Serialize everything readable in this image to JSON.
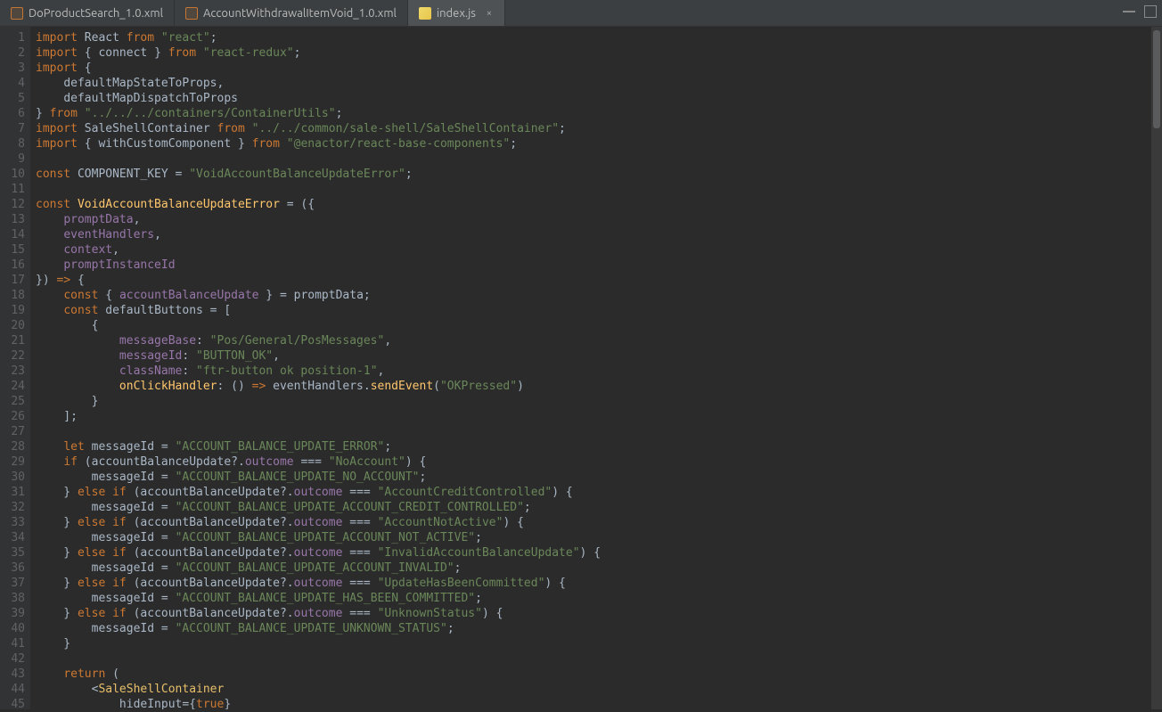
{
  "tabs": [
    {
      "label": "DoProductSearch_1.0.xml",
      "kind": "xml",
      "active": false
    },
    {
      "label": "AccountWithdrawalItemVoid_1.0.xml",
      "kind": "xml",
      "active": false
    },
    {
      "label": "index.js",
      "kind": "js",
      "active": true
    }
  ],
  "code_lines": [
    [
      [
        "kw",
        "import"
      ],
      [
        "pun",
        " "
      ],
      [
        "cls",
        "React"
      ],
      [
        "pun",
        " "
      ],
      [
        "kw",
        "from"
      ],
      [
        "pun",
        " "
      ],
      [
        "str",
        "\"react\""
      ],
      [
        "pun",
        ";"
      ]
    ],
    [
      [
        "kw",
        "import"
      ],
      [
        "pun",
        " { "
      ],
      [
        "cls",
        "connect"
      ],
      [
        "pun",
        " } "
      ],
      [
        "kw",
        "from"
      ],
      [
        "pun",
        " "
      ],
      [
        "str",
        "\"react-redux\""
      ],
      [
        "pun",
        ";"
      ]
    ],
    [
      [
        "kw",
        "import"
      ],
      [
        "pun",
        " {"
      ]
    ],
    [
      [
        "pun",
        "    "
      ],
      [
        "cls",
        "defaultMapStateToProps"
      ],
      [
        "pun",
        ","
      ]
    ],
    [
      [
        "pun",
        "    "
      ],
      [
        "cls",
        "defaultMapDispatchToProps"
      ]
    ],
    [
      [
        "pun",
        "} "
      ],
      [
        "kw",
        "from"
      ],
      [
        "pun",
        " "
      ],
      [
        "str",
        "\"../../../containers/ContainerUtils\""
      ],
      [
        "pun",
        ";"
      ]
    ],
    [
      [
        "kw",
        "import"
      ],
      [
        "pun",
        " "
      ],
      [
        "cls",
        "SaleShellContainer"
      ],
      [
        "pun",
        " "
      ],
      [
        "kw",
        "from"
      ],
      [
        "pun",
        " "
      ],
      [
        "str",
        "\"../../common/sale-shell/SaleShellContainer\""
      ],
      [
        "pun",
        ";"
      ]
    ],
    [
      [
        "kw",
        "import"
      ],
      [
        "pun",
        " { "
      ],
      [
        "cls",
        "withCustomComponent"
      ],
      [
        "pun",
        " } "
      ],
      [
        "kw",
        "from"
      ],
      [
        "pun",
        " "
      ],
      [
        "str",
        "\"@enactor/react-base-components\""
      ],
      [
        "pun",
        ";"
      ]
    ],
    [],
    [
      [
        "kw",
        "const"
      ],
      [
        "pun",
        " "
      ],
      [
        "id",
        "COMPONENT_KEY"
      ],
      [
        "pun",
        " = "
      ],
      [
        "str",
        "\"VoidAccountBalanceUpdateError\""
      ],
      [
        "pun",
        ";"
      ]
    ],
    [],
    [
      [
        "kw",
        "const"
      ],
      [
        "pun",
        " "
      ],
      [
        "fn",
        "VoidAccountBalanceUpdateError"
      ],
      [
        "pun",
        " = ({"
      ]
    ],
    [
      [
        "pun",
        "    "
      ],
      [
        "prop",
        "promptData"
      ],
      [
        "pun",
        ","
      ]
    ],
    [
      [
        "pun",
        "    "
      ],
      [
        "prop",
        "eventHandlers"
      ],
      [
        "pun",
        ","
      ]
    ],
    [
      [
        "pun",
        "    "
      ],
      [
        "prop",
        "context"
      ],
      [
        "pun",
        ","
      ]
    ],
    [
      [
        "pun",
        "    "
      ],
      [
        "prop",
        "promptInstanceId"
      ]
    ],
    [
      [
        "pun",
        "}) "
      ],
      [
        "kw",
        "=>"
      ],
      [
        "pun",
        " {"
      ]
    ],
    [
      [
        "pun",
        "    "
      ],
      [
        "kw",
        "const"
      ],
      [
        "pun",
        " { "
      ],
      [
        "prop",
        "accountBalanceUpdate"
      ],
      [
        "pun",
        " } = "
      ],
      [
        "id",
        "promptData"
      ],
      [
        "pun",
        ";"
      ]
    ],
    [
      [
        "pun",
        "    "
      ],
      [
        "kw",
        "const"
      ],
      [
        "pun",
        " "
      ],
      [
        "id",
        "defaultButtons"
      ],
      [
        "pun",
        " = ["
      ]
    ],
    [
      [
        "pun",
        "        {"
      ]
    ],
    [
      [
        "pun",
        "            "
      ],
      [
        "prop",
        "messageBase"
      ],
      [
        "pun",
        ": "
      ],
      [
        "str",
        "\"Pos/General/PosMessages\""
      ],
      [
        "pun",
        ","
      ]
    ],
    [
      [
        "pun",
        "            "
      ],
      [
        "prop",
        "messageId"
      ],
      [
        "pun",
        ": "
      ],
      [
        "str",
        "\"BUTTON_OK\""
      ],
      [
        "pun",
        ","
      ]
    ],
    [
      [
        "pun",
        "            "
      ],
      [
        "prop",
        "className"
      ],
      [
        "pun",
        ": "
      ],
      [
        "str",
        "\"ftr-button ok position-1\""
      ],
      [
        "pun",
        ","
      ]
    ],
    [
      [
        "pun",
        "            "
      ],
      [
        "fn",
        "onClickHandler"
      ],
      [
        "pun",
        ": () "
      ],
      [
        "kw",
        "=>"
      ],
      [
        "pun",
        " "
      ],
      [
        "id",
        "eventHandlers"
      ],
      [
        "pun",
        "."
      ],
      [
        "fn",
        "sendEvent"
      ],
      [
        "pun",
        "("
      ],
      [
        "str",
        "\"OKPressed\""
      ],
      [
        "pun",
        ")"
      ]
    ],
    [
      [
        "pun",
        "        }"
      ]
    ],
    [
      [
        "pun",
        "    ];"
      ]
    ],
    [],
    [
      [
        "pun",
        "    "
      ],
      [
        "kw",
        "let"
      ],
      [
        "pun",
        " "
      ],
      [
        "id",
        "messageId"
      ],
      [
        "pun",
        " = "
      ],
      [
        "str",
        "\"ACCOUNT_BALANCE_UPDATE_ERROR\""
      ],
      [
        "pun",
        ";"
      ]
    ],
    [
      [
        "pun",
        "    "
      ],
      [
        "kw",
        "if"
      ],
      [
        "pun",
        " ("
      ],
      [
        "id",
        "accountBalanceUpdate"
      ],
      [
        "pun",
        "?."
      ],
      [
        "prop",
        "outcome"
      ],
      [
        "pun",
        " === "
      ],
      [
        "str",
        "\"NoAccount\""
      ],
      [
        "pun",
        ") {"
      ]
    ],
    [
      [
        "pun",
        "        "
      ],
      [
        "id",
        "messageId"
      ],
      [
        "pun",
        " = "
      ],
      [
        "str",
        "\"ACCOUNT_BALANCE_UPDATE_NO_ACCOUNT\""
      ],
      [
        "pun",
        ";"
      ]
    ],
    [
      [
        "pun",
        "    } "
      ],
      [
        "kw",
        "else if"
      ],
      [
        "pun",
        " ("
      ],
      [
        "id",
        "accountBalanceUpdate"
      ],
      [
        "pun",
        "?."
      ],
      [
        "prop",
        "outcome"
      ],
      [
        "pun",
        " === "
      ],
      [
        "str",
        "\"AccountCreditControlled\""
      ],
      [
        "pun",
        ") {"
      ]
    ],
    [
      [
        "pun",
        "        "
      ],
      [
        "id",
        "messageId"
      ],
      [
        "pun",
        " = "
      ],
      [
        "str",
        "\"ACCOUNT_BALANCE_UPDATE_ACCOUNT_CREDIT_CONTROLLED\""
      ],
      [
        "pun",
        ";"
      ]
    ],
    [
      [
        "pun",
        "    } "
      ],
      [
        "kw",
        "else if"
      ],
      [
        "pun",
        " ("
      ],
      [
        "id",
        "accountBalanceUpdate"
      ],
      [
        "pun",
        "?."
      ],
      [
        "prop",
        "outcome"
      ],
      [
        "pun",
        " === "
      ],
      [
        "str",
        "\"AccountNotActive\""
      ],
      [
        "pun",
        ") {"
      ]
    ],
    [
      [
        "pun",
        "        "
      ],
      [
        "id",
        "messageId"
      ],
      [
        "pun",
        " = "
      ],
      [
        "str",
        "\"ACCOUNT_BALANCE_UPDATE_ACCOUNT_NOT_ACTIVE\""
      ],
      [
        "pun",
        ";"
      ]
    ],
    [
      [
        "pun",
        "    } "
      ],
      [
        "kw",
        "else if"
      ],
      [
        "pun",
        " ("
      ],
      [
        "id",
        "accountBalanceUpdate"
      ],
      [
        "pun",
        "?."
      ],
      [
        "prop",
        "outcome"
      ],
      [
        "pun",
        " === "
      ],
      [
        "str",
        "\"InvalidAccountBalanceUpdate\""
      ],
      [
        "pun",
        ") {"
      ]
    ],
    [
      [
        "pun",
        "        "
      ],
      [
        "id",
        "messageId"
      ],
      [
        "pun",
        " = "
      ],
      [
        "str",
        "\"ACCOUNT_BALANCE_UPDATE_ACCOUNT_INVALID\""
      ],
      [
        "pun",
        ";"
      ]
    ],
    [
      [
        "pun",
        "    } "
      ],
      [
        "kw",
        "else if"
      ],
      [
        "pun",
        " ("
      ],
      [
        "id",
        "accountBalanceUpdate"
      ],
      [
        "pun",
        "?."
      ],
      [
        "prop",
        "outcome"
      ],
      [
        "pun",
        " === "
      ],
      [
        "str",
        "\"UpdateHasBeenCommitted\""
      ],
      [
        "pun",
        ") {"
      ]
    ],
    [
      [
        "pun",
        "        "
      ],
      [
        "id",
        "messageId"
      ],
      [
        "pun",
        " = "
      ],
      [
        "str",
        "\"ACCOUNT_BALANCE_UPDATE_HAS_BEEN_COMMITTED\""
      ],
      [
        "pun",
        ";"
      ]
    ],
    [
      [
        "pun",
        "    } "
      ],
      [
        "kw",
        "else if"
      ],
      [
        "pun",
        " ("
      ],
      [
        "id",
        "accountBalanceUpdate"
      ],
      [
        "pun",
        "?."
      ],
      [
        "prop",
        "outcome"
      ],
      [
        "pun",
        " === "
      ],
      [
        "str",
        "\"UnknownStatus\""
      ],
      [
        "pun",
        ") {"
      ]
    ],
    [
      [
        "pun",
        "        "
      ],
      [
        "id",
        "messageId"
      ],
      [
        "pun",
        " = "
      ],
      [
        "str",
        "\"ACCOUNT_BALANCE_UPDATE_UNKNOWN_STATUS\""
      ],
      [
        "pun",
        ";"
      ]
    ],
    [
      [
        "pun",
        "    }"
      ]
    ],
    [],
    [
      [
        "pun",
        "    "
      ],
      [
        "kw",
        "return"
      ],
      [
        "pun",
        " ("
      ]
    ],
    [
      [
        "pun",
        "        <"
      ],
      [
        "jsxtag",
        "SaleShellContainer"
      ]
    ],
    [
      [
        "pun",
        "            "
      ],
      [
        "jsxattr",
        "hideInput"
      ],
      [
        "pun",
        "={"
      ],
      [
        "kw",
        "true"
      ],
      [
        "pun",
        "}"
      ]
    ]
  ]
}
